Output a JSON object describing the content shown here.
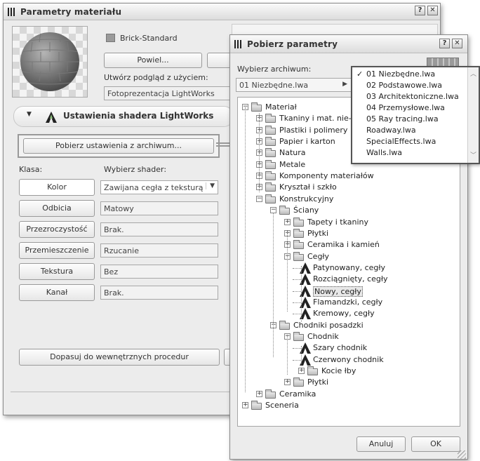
{
  "main_window": {
    "title": "Parametry materiału",
    "material_name": "Brick-Standard",
    "duplicate_btn": "Powiel...",
    "preview_label": "Utwórz podgląd z użyciem:",
    "preview_value": "Fotoprezentacja LightWorks",
    "shader_section_title": "Ustawienia shadera LightWorks",
    "fetch_btn": "Pobierz ustawienia z archiwum...",
    "class_header": "Klasa:",
    "shader_header": "Wybierz shader:",
    "rows": [
      {
        "class": "Kolor",
        "shader": "Zawijana cegła z teksturą",
        "dropdown": true
      },
      {
        "class": "Odbicia",
        "shader": "Matowy"
      },
      {
        "class": "Przezroczystość",
        "shader": "Brak."
      },
      {
        "class": "Przemieszczenie",
        "shader": "Rzucanie"
      },
      {
        "class": "Tekstura",
        "shader": "Bez"
      },
      {
        "class": "Kanał",
        "shader": "Brak."
      }
    ],
    "procedures_btn": "Dopasuj do wewnętrznych procedur"
  },
  "dialog": {
    "title": "Pobierz parametry",
    "archive_label": "Wybierz archiwum:",
    "archive_value": "01 Niezbędne.lwa",
    "cancel_btn": "Anuluj",
    "ok_btn": "OK"
  },
  "archive_dropdown": {
    "items": [
      "01 Niezbędne.lwa",
      "02 Podstawowe.lwa",
      "03 Architektoniczne.lwa",
      "04 Przemysłowe.lwa",
      "05 Ray tracing.lwa",
      "Roadway.lwa",
      "SpecialEffects.lwa",
      "Walls.lwa"
    ],
    "checked": "01 Niezbędne.lwa"
  },
  "tree": {
    "material": "Materiał",
    "tkaniny": "Tkaniny i mat. nie-tk",
    "plastiki": "Plastiki i polimery",
    "papier": "Papier i karton",
    "natura": "Natura",
    "metale": "Metale",
    "komponenty": "Komponenty materiałów",
    "krysztal": "Kryształ i szkło",
    "konstrukcyjny": "Konstrukcyjny",
    "sciany": "Ściany",
    "tapety": "Tapety i tkaniny",
    "plytki1": "Płytki",
    "ceramika_kamien": "Ceramika i kamień",
    "cegly": "Cegły",
    "patynowany": "Patynowany, cegły",
    "rozciagniety": "Rozciągnięty, cegły",
    "nowy": "Nowy, cegły",
    "flamandzki": "Flamandzki, cegły",
    "kremowy": "Kremowy, cegły",
    "chodniki": "Chodniki posadzki",
    "chodnik": "Chodnik",
    "szary": "Szary chodnik",
    "czerwony": "Czerwony chodnik",
    "kocie": "Kocie łby",
    "plytki2": "Płytki",
    "ceramika": "Ceramika",
    "sceneria": "Sceneria"
  },
  "colors": {
    "accent_green": "#8cbf7a",
    "selection": "#e8e8e8"
  }
}
